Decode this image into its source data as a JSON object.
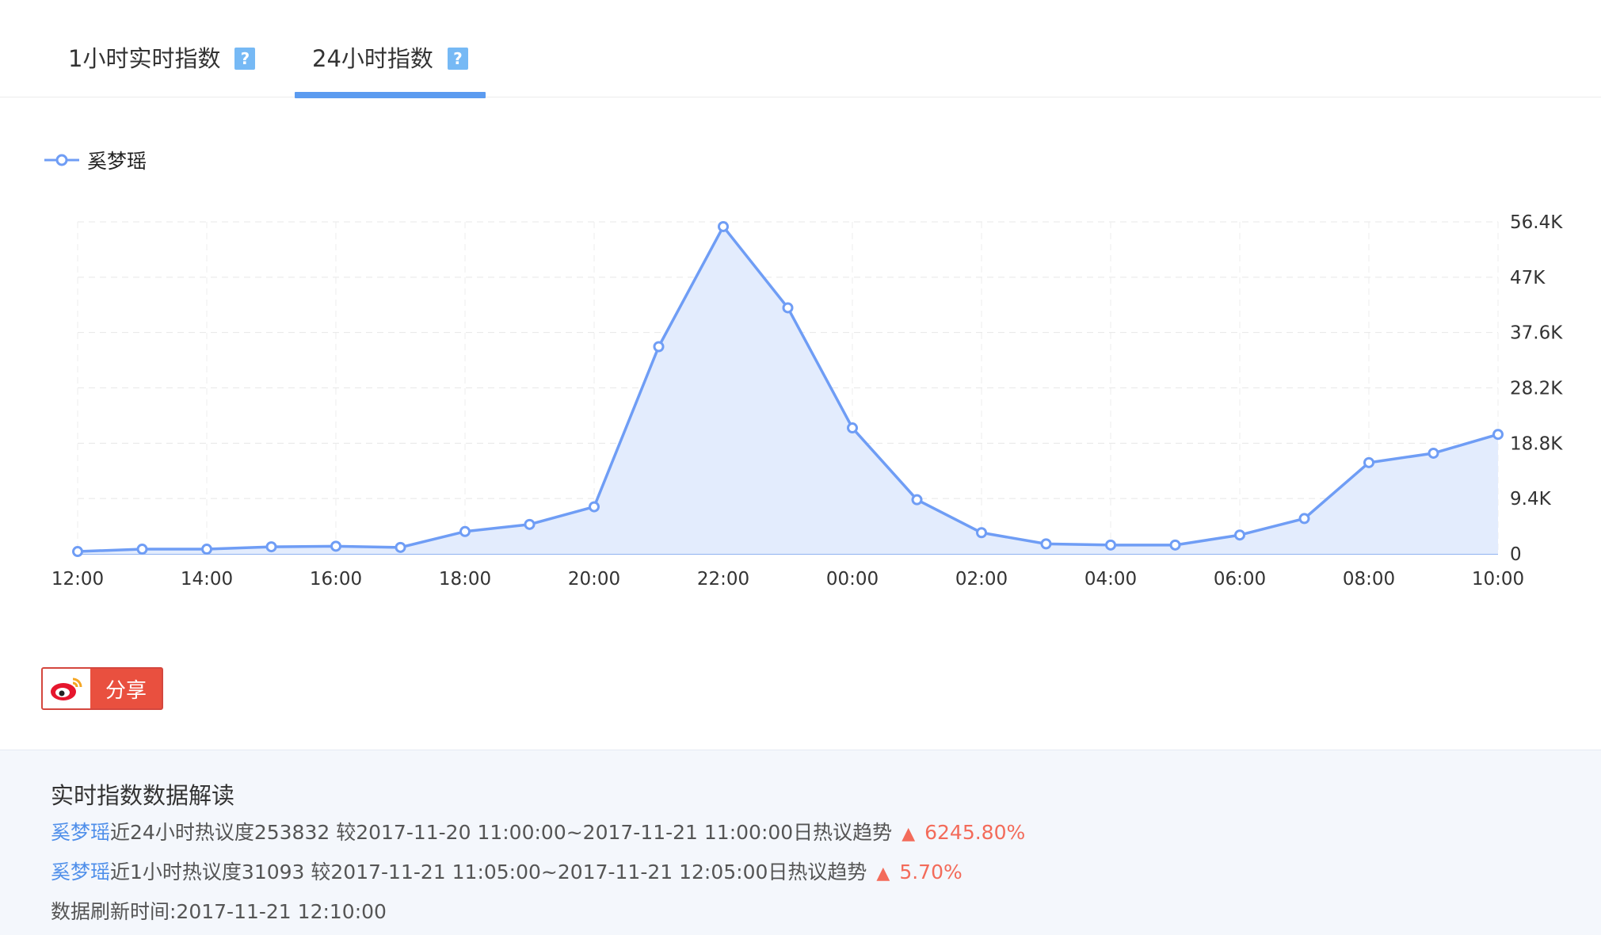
{
  "tabs": [
    {
      "label": "1小时实时指数",
      "help": "?"
    },
    {
      "label": "24小时指数",
      "help": "?",
      "active": true
    }
  ],
  "legend": {
    "series_name": "奚梦瑶"
  },
  "chart_data": {
    "type": "area",
    "x": [
      "12:00",
      "13:00",
      "14:00",
      "15:00",
      "16:00",
      "17:00",
      "18:00",
      "19:00",
      "20:00",
      "21:00",
      "22:00",
      "23:00",
      "00:00",
      "01:00",
      "02:00",
      "03:00",
      "04:00",
      "05:00",
      "06:00",
      "07:00",
      "08:00",
      "09:00",
      "10:00"
    ],
    "x_tick_labels": [
      "12:00",
      "14:00",
      "16:00",
      "18:00",
      "20:00",
      "22:00",
      "00:00",
      "02:00",
      "04:00",
      "06:00",
      "08:00",
      "10:00"
    ],
    "series": [
      {
        "name": "奚梦瑶",
        "values": [
          400,
          800,
          800,
          1200,
          1300,
          1100,
          3800,
          5000,
          8000,
          35200,
          55600,
          41800,
          21400,
          9200,
          3600,
          1700,
          1500,
          1500,
          3200,
          6000,
          15500,
          17100,
          20300
        ]
      }
    ],
    "y_tick_labels": [
      "0",
      "9.4K",
      "18.8K",
      "28.2K",
      "37.6K",
      "47K",
      "56.4K"
    ],
    "ylim": [
      0,
      56400
    ],
    "y_axis_position": "right",
    "grid": true,
    "legend_position": "top-left",
    "line_color": "#6f9df5",
    "fill_color": "#e3ecfd"
  },
  "share": {
    "label": "分享"
  },
  "panel": {
    "title": "实时指数数据解读",
    "lines": [
      {
        "name": "奚梦瑶",
        "text": "近24小时热议度253832   较2017-11-20 11:00:00~2017-11-21 11:00:00日热议趋势",
        "pct": "6245.80%"
      },
      {
        "name": "奚梦瑶",
        "text": "近1小时热议度31093   较2017-11-21 11:05:00~2017-11-21 12:05:00日热议趋势",
        "pct": "5.70%"
      }
    ],
    "refresh": "数据刷新时间:2017-11-21 12:10:00"
  },
  "colors": {
    "accent": "#5b9bf0",
    "up": "#f36b5a",
    "name": "#4f8fea"
  }
}
